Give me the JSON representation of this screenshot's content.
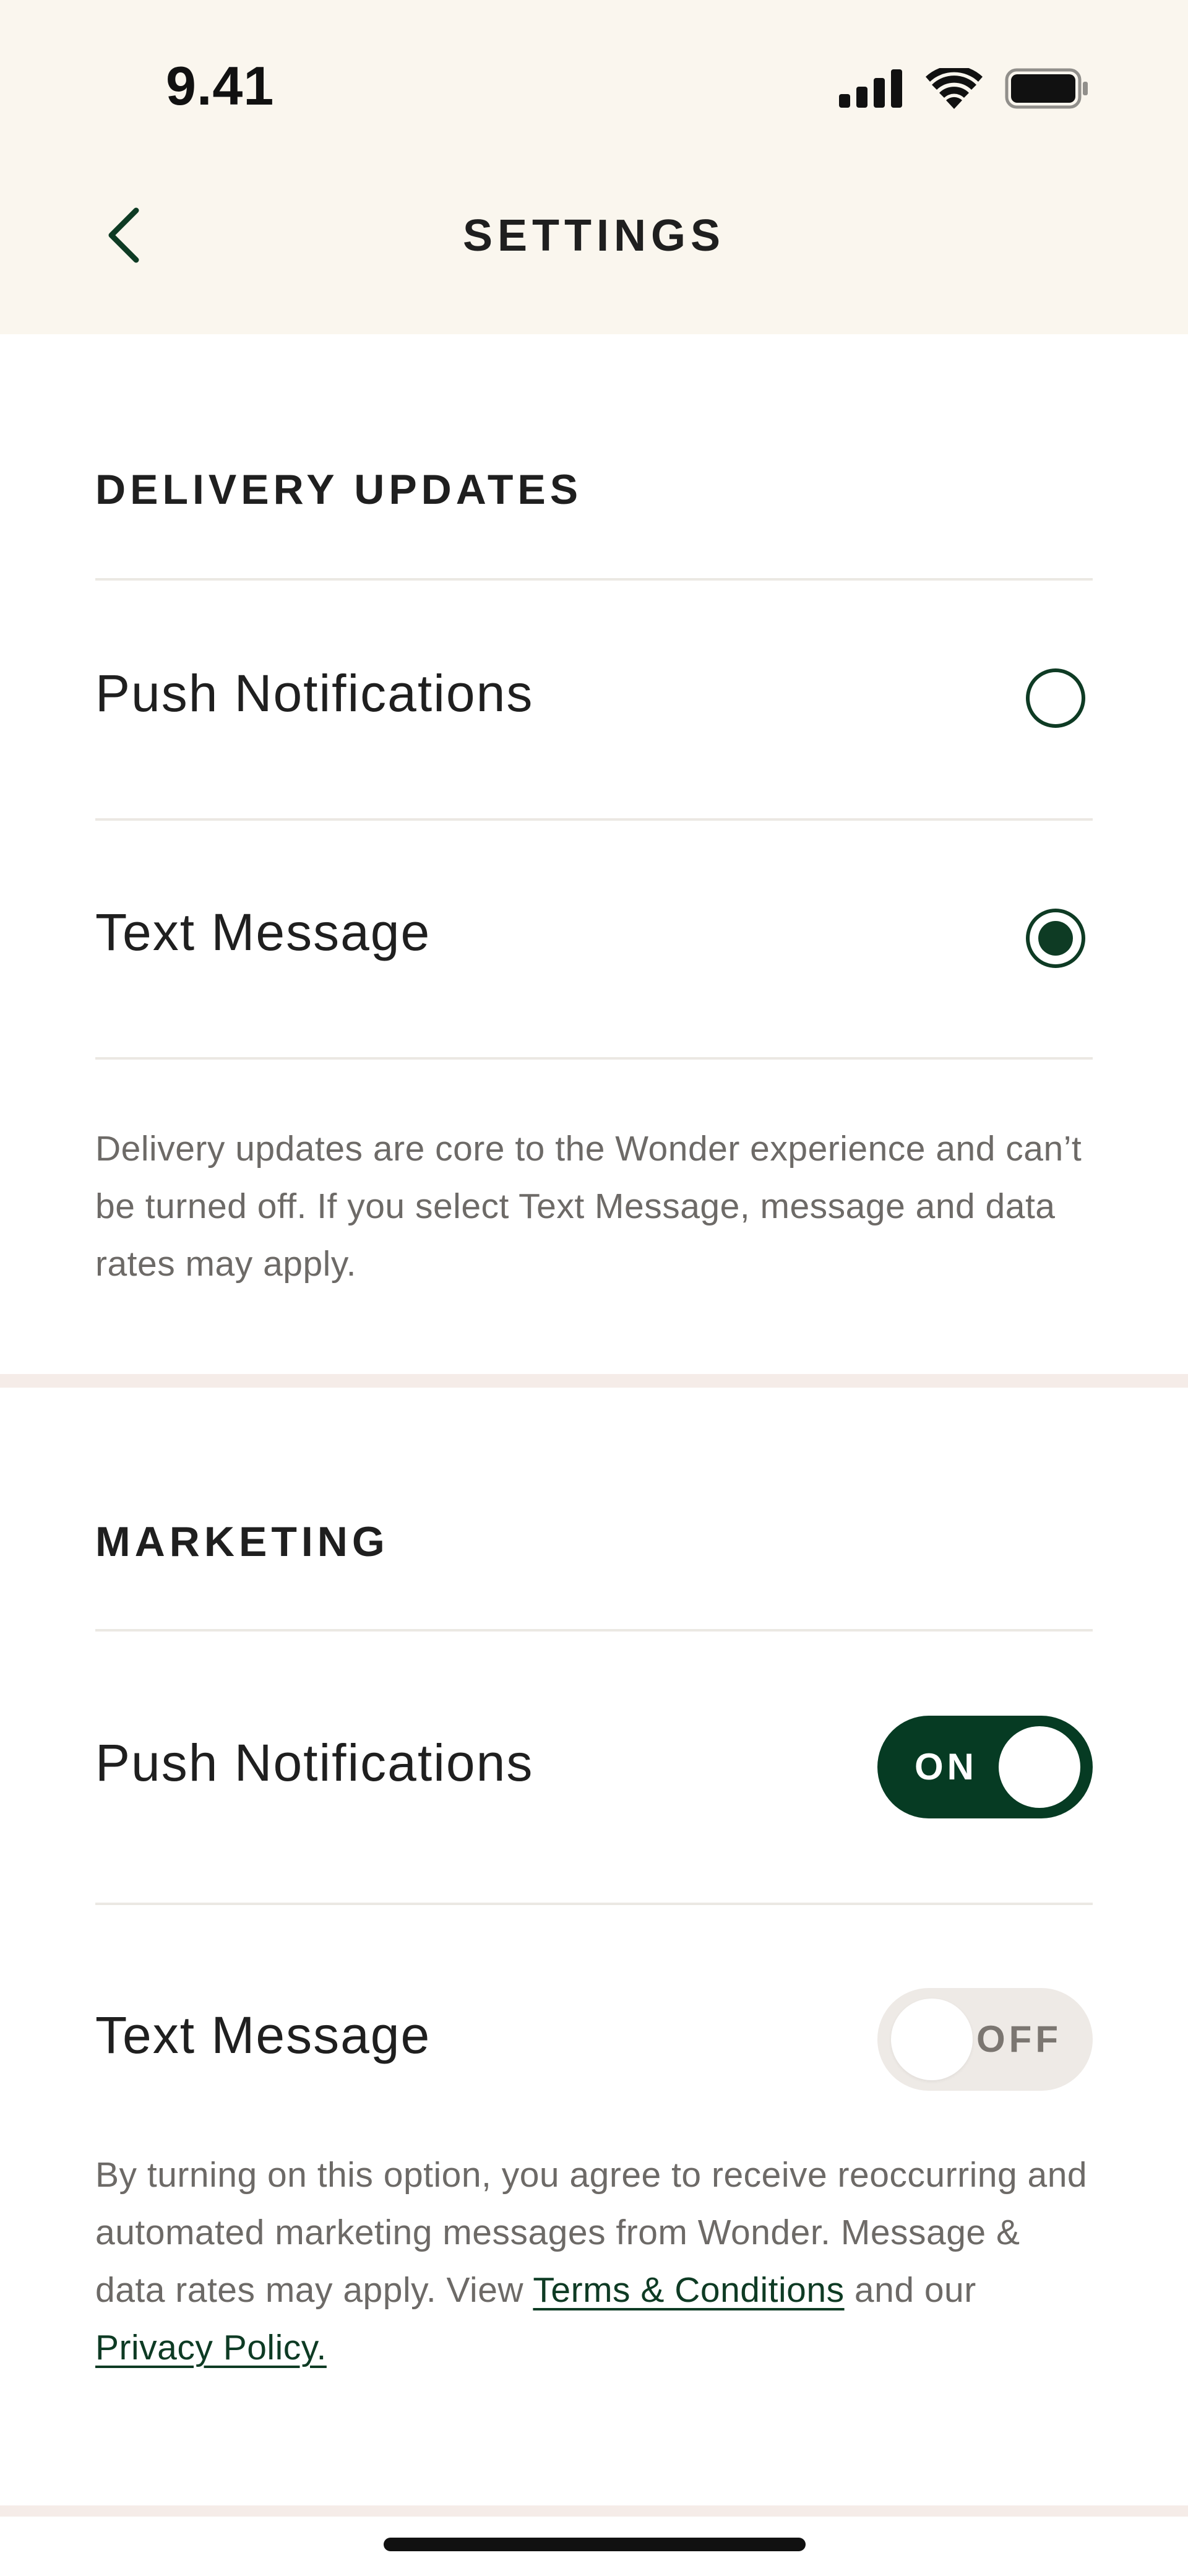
{
  "status_bar": {
    "time": "9.41"
  },
  "header": {
    "title": "SETTINGS"
  },
  "delivery_updates": {
    "heading": "DELIVERY UPDATES",
    "options": [
      {
        "label": "Push Notifications",
        "selected": false
      },
      {
        "label": "Text Message",
        "selected": true
      }
    ],
    "note": "Delivery updates are core to the Wonder experience and can’t be turned off. If you select Text Message, message and data rates may apply."
  },
  "marketing": {
    "heading": "MARKETING",
    "push": {
      "label": "Push Notifications",
      "toggle_text": "ON",
      "state": "on"
    },
    "text": {
      "label": "Text Message",
      "toggle_text": "OFF",
      "state": "off"
    },
    "note_prefix": "By turning on this option, you agree to receive reoccurring and automated marketing messages from Wonder. Message & data rates may apply. View ",
    "terms_link": "Terms & Conditions",
    "note_middle": " and our ",
    "privacy_link": "Privacy Policy."
  },
  "colors": {
    "accent": "#0e3b24",
    "header_bg": "#faf6ee",
    "off_track": "#eeeae6"
  }
}
